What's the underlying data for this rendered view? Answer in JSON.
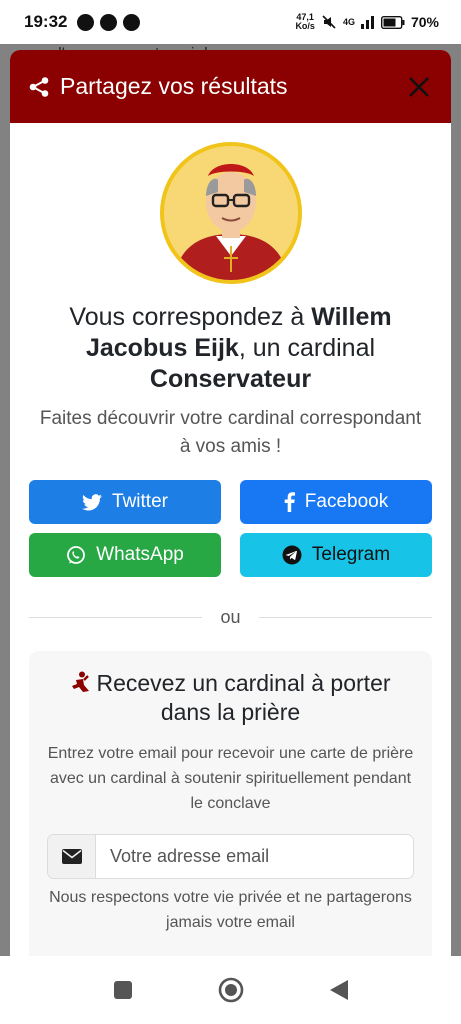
{
  "status_bar": {
    "time": "19:32",
    "app_icons": [
      "notification-icon-1",
      "notification-icon-2",
      "notification-icon-3"
    ],
    "speed_value": "47,1",
    "speed_unit": "Ko/s",
    "network": "4G",
    "battery": "70%"
  },
  "background_page": {
    "text": "l'engagement social"
  },
  "modal": {
    "title": "Partagez vos résultats",
    "header_color": "#8b0000",
    "result_prefix": "Vous correspondez à ",
    "cardinal_name": "Willem Jacobus Eijk",
    "result_middle": ", un cardinal ",
    "cardinal_type": "Conservateur",
    "subtitle": "Faites découvrir votre cardinal correspondant à vos amis !",
    "share_buttons": {
      "twitter": "Twitter",
      "facebook": "Facebook",
      "whatsapp": "WhatsApp",
      "telegram": "Telegram"
    },
    "divider_text": "ou",
    "prayer": {
      "title": "Recevez un cardinal à porter dans la prière",
      "description": "Entrez votre email pour recevoir une carte de prière avec un cardinal à soutenir spirituellement pendant le conclave",
      "email_placeholder": "Votre adresse email",
      "privacy": "Nous respectons votre vie privée et ne partagerons jamais votre email"
    }
  },
  "nav_bar": {
    "buttons": [
      "recents-square-icon",
      "home-circle-icon",
      "back-triangle-icon"
    ]
  }
}
